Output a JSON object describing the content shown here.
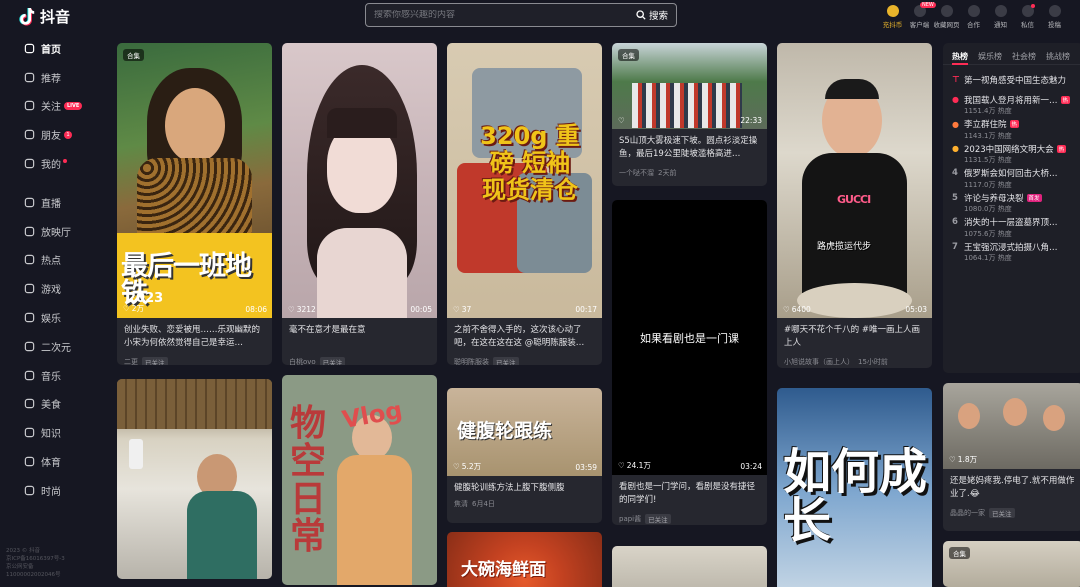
{
  "app": {
    "name": "抖音"
  },
  "search": {
    "placeholder": "搜索你感兴趣的内容",
    "button_label": "搜索"
  },
  "top_actions": [
    {
      "label": "充抖币",
      "icon": "coin-icon",
      "badge": ""
    },
    {
      "label": "客户端",
      "icon": "desktop-icon",
      "badge": "NEW"
    },
    {
      "label": "收藏网页",
      "icon": "star-icon",
      "badge": ""
    },
    {
      "label": "合作",
      "icon": "handshake-icon",
      "badge": ""
    },
    {
      "label": "通知",
      "icon": "bell-icon",
      "badge": ""
    },
    {
      "label": "私信",
      "icon": "message-icon",
      "badge": "dot"
    },
    {
      "label": "投稿",
      "icon": "upload-icon",
      "badge": ""
    }
  ],
  "sidebar": {
    "items": [
      {
        "label": "首页",
        "icon": "home-icon",
        "extra": ""
      },
      {
        "label": "推荐",
        "icon": "recommend-icon",
        "extra": ""
      },
      {
        "label": "关注",
        "icon": "follow-icon",
        "extra": "LIVE"
      },
      {
        "label": "朋友",
        "icon": "friends-icon",
        "extra": "1"
      },
      {
        "label": "我的",
        "icon": "user-icon",
        "extra": "dot"
      },
      {
        "label": "直播",
        "icon": "live-icon",
        "extra": ""
      },
      {
        "label": "放映厅",
        "icon": "cinema-icon",
        "extra": ""
      },
      {
        "label": "热点",
        "icon": "flame-icon",
        "extra": ""
      },
      {
        "label": "游戏",
        "icon": "game-icon",
        "extra": ""
      },
      {
        "label": "娱乐",
        "icon": "entertainment-icon",
        "extra": ""
      },
      {
        "label": "二次元",
        "icon": "anime-icon",
        "extra": ""
      },
      {
        "label": "音乐",
        "icon": "music-icon",
        "extra": ""
      },
      {
        "label": "美食",
        "icon": "food-icon",
        "extra": ""
      },
      {
        "label": "知识",
        "icon": "knowledge-icon",
        "extra": ""
      },
      {
        "label": "体育",
        "icon": "sports-icon",
        "extra": ""
      },
      {
        "label": "时尚",
        "icon": "fashion-icon",
        "extra": ""
      }
    ],
    "footer": [
      "2023 © 抖音",
      "京ICP备16016397号-3",
      "京公网安备",
      "11000002002046号"
    ]
  },
  "feed": {
    "col1": [
      {
        "tag": "合集",
        "thumb_title": "最后一班地铁",
        "thumb_sub": "2023",
        "likes": "2万",
        "duration": "08:06",
        "caption": "创业失败、恋爱被甩……乐观幽默的小宋为何依然觉得自己是幸运…",
        "author": "二更",
        "follow": "已关注"
      },
      {
        "tag": "",
        "thumb_title": "",
        "thumb_sub": "",
        "likes": "",
        "duration": "",
        "caption": "",
        "author": "",
        "follow": ""
      }
    ],
    "col2": [
      {
        "tag": "",
        "thumb_title": "",
        "thumb_sub": "",
        "likes": "3212",
        "duration": "00:05",
        "caption": "毫不在意才是最在意",
        "author": "白桃ovo",
        "follow": "已关注"
      },
      {
        "tag": "",
        "thumb_title": "物空日常",
        "thumb_sub": "Vlog",
        "likes": "",
        "duration": "",
        "caption": "",
        "author": "",
        "follow": ""
      }
    ],
    "col3": [
      {
        "tag": "",
        "thumb_title": "320g 重磅 短袖 现货清仓",
        "thumb_sub": "",
        "likes": "37",
        "duration": "00:17",
        "caption": "之前不舍得入手的，这次该心动了吧，在这在这在这 @聪明陈服装…",
        "author": "聪明陈服装",
        "follow": "已关注"
      },
      {
        "tag": "",
        "thumb_title": "健腹轮跟练",
        "thumb_sub": "",
        "likes": "5.2万",
        "duration": "03:59",
        "caption": "健腹轮训练方法上腹下腹侧腹",
        "author": "焦清",
        "date": "6月4日",
        "follow": ""
      },
      {
        "tag": "",
        "thumb_title": "大碗海鲜面",
        "thumb_sub": "",
        "likes": "",
        "duration": "",
        "caption": "",
        "author": "",
        "follow": ""
      }
    ],
    "col4": [
      {
        "tag": "合集",
        "thumb_title": "",
        "thumb_sub": "",
        "likes": "",
        "duration": "22:33",
        "caption": "S5山顶大雾极速下坡。圆点衫淡定操鱼，最后19公里陡坡滥格高进…",
        "author": "一个哒不溜",
        "date": "2天前",
        "follow": ""
      },
      {
        "tag": "",
        "thumb_title": "如果看剧也是一门课",
        "thumb_sub": "",
        "likes": "24.1万",
        "duration": "03:24",
        "caption": "看剧也是一门学问，看剧是没有捷径的同学们!",
        "author": "papi酱",
        "follow": "已关注"
      },
      {
        "tag": "",
        "thumb_title": "",
        "thumb_sub": "",
        "likes": "",
        "duration": "",
        "caption": "",
        "author": "",
        "follow": ""
      }
    ],
    "col5": [
      {
        "tag": "",
        "thumb_title": "路虎揽运代步",
        "thumb_sub": "",
        "likes": "6400",
        "duration": "05:03",
        "caption": "#哪天不花个千八的 #唯一画上人画上人",
        "author": "小旭说故事（画上人）",
        "date": "15小时前",
        "follow": ""
      },
      {
        "tag": "",
        "thumb_title": "如何成长",
        "thumb_sub": "",
        "likes": "",
        "duration": "",
        "caption": "",
        "author": "",
        "follow": ""
      }
    ]
  },
  "hot": {
    "tabs": [
      "热榜",
      "娱乐榜",
      "社会榜",
      "挑战榜"
    ],
    "items": [
      {
        "rank": "",
        "title": "第一视角感受中国生态魅力",
        "heat": "",
        "badge": "",
        "badge_color": "",
        "icon": "pin-icon"
      },
      {
        "rank": "1",
        "title": "我国载人登月将用新一…",
        "heat": "1151.4万 热度",
        "badge": "热",
        "badge_color": "#fe2c55",
        "icon": "fire-icon"
      },
      {
        "rank": "2",
        "title": "李立群住院",
        "heat": "1143.1万 热度",
        "badge": "热",
        "badge_color": "#fe2c55",
        "icon": "fire-icon"
      },
      {
        "rank": "3",
        "title": "2023中国网络文明大会",
        "heat": "1131.5万 热度",
        "badge": "热",
        "badge_color": "#fe2c55",
        "icon": "fire-icon"
      },
      {
        "rank": "4",
        "title": "俄罗斯会如何回击大桥…",
        "heat": "1117.0万 热度",
        "badge": "",
        "badge_color": "",
        "icon": ""
      },
      {
        "rank": "5",
        "title": "许论与养母决裂",
        "heat": "1080.0万 热度",
        "badge": "首发",
        "badge_color": "#e0227d",
        "icon": ""
      },
      {
        "rank": "6",
        "title": "消失的十一层盗墓界顶…",
        "heat": "1075.6万 热度",
        "badge": "",
        "badge_color": "",
        "icon": ""
      },
      {
        "rank": "7",
        "title": "王宝强沉浸式拍摄八角…",
        "heat": "1064.1万 热度",
        "badge": "",
        "badge_color": "",
        "icon": ""
      }
    ]
  },
  "hot_card": {
    "likes": "1.8万",
    "caption": "还是姥妈疼我.停电了.就不用做作业了.😂",
    "author": "晶晶的一家",
    "follow": "已关注"
  },
  "hot_card2": {
    "tag": "合集"
  }
}
